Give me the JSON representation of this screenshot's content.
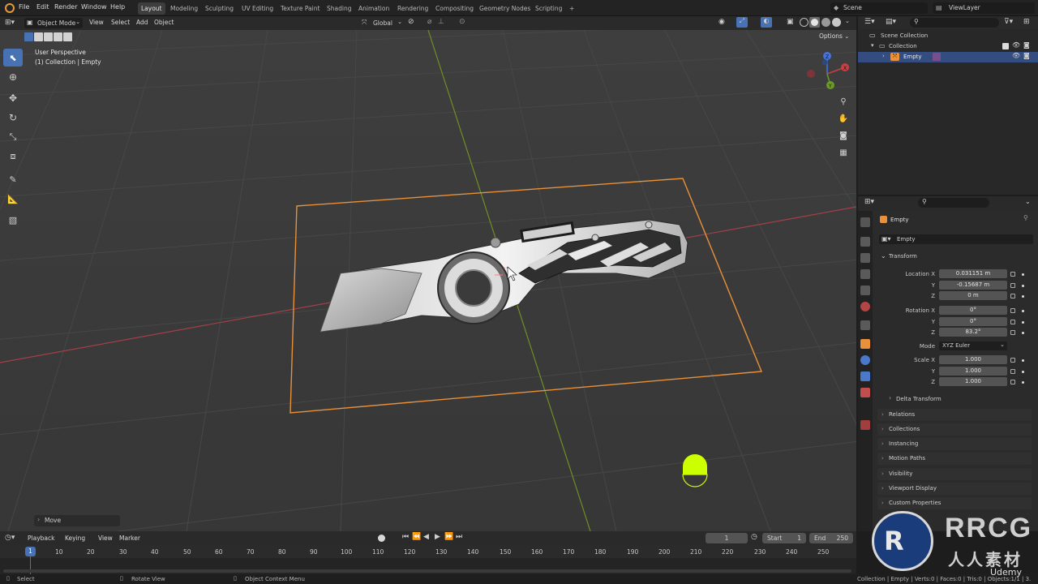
{
  "topbar": {
    "menus": [
      "File",
      "Edit",
      "Render",
      "Window",
      "Help"
    ],
    "workspaces": [
      "Layout",
      "Modeling",
      "Sculpting",
      "UV Editing",
      "Texture Paint",
      "Shading",
      "Animation",
      "Rendering",
      "Compositing",
      "Geometry Nodes",
      "Scripting"
    ],
    "add_tab": "+",
    "scene_label": "Scene",
    "viewlayer_label": "ViewLayer"
  },
  "viewport": {
    "mode": "Object Mode",
    "menus": [
      "View",
      "Select",
      "Add",
      "Object"
    ],
    "transform_orientation": "Global",
    "options_label": "Options",
    "info_line1": "User Perspective",
    "info_line2": "(1) Collection | Empty",
    "last_op": "Move",
    "gizmo_axes": [
      "X",
      "Y",
      "Z"
    ]
  },
  "outliner": {
    "search_placeholder": "",
    "items": [
      "Scene Collection",
      "Collection",
      "Empty"
    ]
  },
  "properties": {
    "object_name": "Empty",
    "object_data_name": "Empty",
    "transform_label": "Transform",
    "location_x_label": "Location X",
    "location_x": "0.031151 m",
    "location_y_label": "Y",
    "location_y": "-0.15687 m",
    "location_z_label": "Z",
    "location_z": "0 m",
    "rotation_x_label": "Rotation X",
    "rotation_x": "0°",
    "rotation_y_label": "Y",
    "rotation_y": "0°",
    "rotation_z_label": "Z",
    "rotation_z": "83.2°",
    "mode_label": "Mode",
    "mode_value": "XYZ Euler",
    "scale_x_label": "Scale X",
    "scale_x": "1.000",
    "scale_y_label": "Y",
    "scale_y": "1.000",
    "scale_z_label": "Z",
    "scale_z": "1.000",
    "delta_transform": "Delta Transform",
    "panels": [
      "Relations",
      "Collections",
      "Instancing",
      "Motion Paths",
      "Visibility",
      "Viewport Display",
      "Custom Properties"
    ]
  },
  "timeline": {
    "menus": [
      "Playback",
      "Keying",
      "View",
      "Marker"
    ],
    "current_frame": "1",
    "start_label": "Start",
    "start_value": "1",
    "end_label": "End",
    "end_value": "250",
    "ticks": [
      "1",
      "10",
      "20",
      "30",
      "40",
      "50",
      "60",
      "70",
      "80",
      "90",
      "100",
      "110",
      "120",
      "130",
      "140",
      "150",
      "160",
      "170",
      "180",
      "190",
      "200",
      "210",
      "220",
      "230",
      "240",
      "250"
    ]
  },
  "statusbar": {
    "select": "Select",
    "rotate_view": "Rotate View",
    "context_menu": "Object Context Menu",
    "stats": "Collection | Empty | Verts:0 | Faces:0 | Tris:0 | Objects:1/1 | 3."
  },
  "watermark": {
    "brand": "RRCG",
    "subtitle": "人人素材",
    "udemy": "Udemy"
  },
  "colors": {
    "accent": "#4772b3",
    "selection_orange": "#e8913a",
    "axis_red": "#c54045",
    "axis_green": "#7a9b27",
    "highlight_yellow": "#ccff00"
  }
}
